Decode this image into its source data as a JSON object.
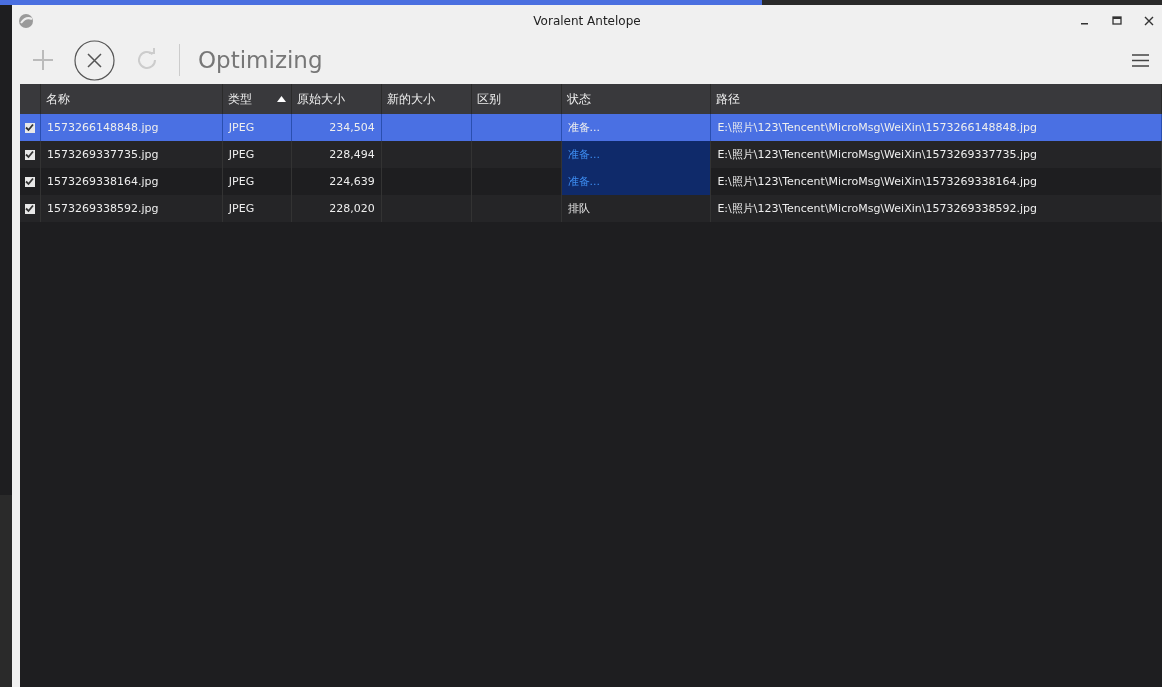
{
  "window": {
    "title": "Voralent Antelope"
  },
  "toolbar": {
    "status": "Optimizing"
  },
  "table": {
    "columns": [
      {
        "label": "名称",
        "sorted": false
      },
      {
        "label": "类型",
        "sorted": true
      },
      {
        "label": "原始大小",
        "sorted": false
      },
      {
        "label": "新的大小",
        "sorted": false
      },
      {
        "label": "区别",
        "sorted": false
      },
      {
        "label": "状态",
        "sorted": false
      },
      {
        "label": "路径",
        "sorted": false
      }
    ],
    "rows": [
      {
        "checked": true,
        "selected": true,
        "active": true,
        "cells": [
          "1573266148848.jpg",
          "JPEG",
          "234,504",
          "",
          "",
          "准备...",
          "E:\\照片\\123\\Tencent\\MicroMsg\\WeiXin\\1573266148848.jpg"
        ]
      },
      {
        "checked": true,
        "selected": false,
        "active": true,
        "cells": [
          "1573269337735.jpg",
          "JPEG",
          "228,494",
          "",
          "",
          "准备...",
          "E:\\照片\\123\\Tencent\\MicroMsg\\WeiXin\\1573269337735.jpg"
        ]
      },
      {
        "checked": true,
        "selected": false,
        "active": true,
        "cells": [
          "1573269338164.jpg",
          "JPEG",
          "224,639",
          "",
          "",
          "准备...",
          "E:\\照片\\123\\Tencent\\MicroMsg\\WeiXin\\1573269338164.jpg"
        ]
      },
      {
        "checked": true,
        "selected": false,
        "active": false,
        "cells": [
          "1573269338592.jpg",
          "JPEG",
          "228,020",
          "",
          "",
          "排队",
          "E:\\照片\\123\\Tencent\\MicroMsg\\WeiXin\\1573269338592.jpg"
        ]
      }
    ]
  }
}
